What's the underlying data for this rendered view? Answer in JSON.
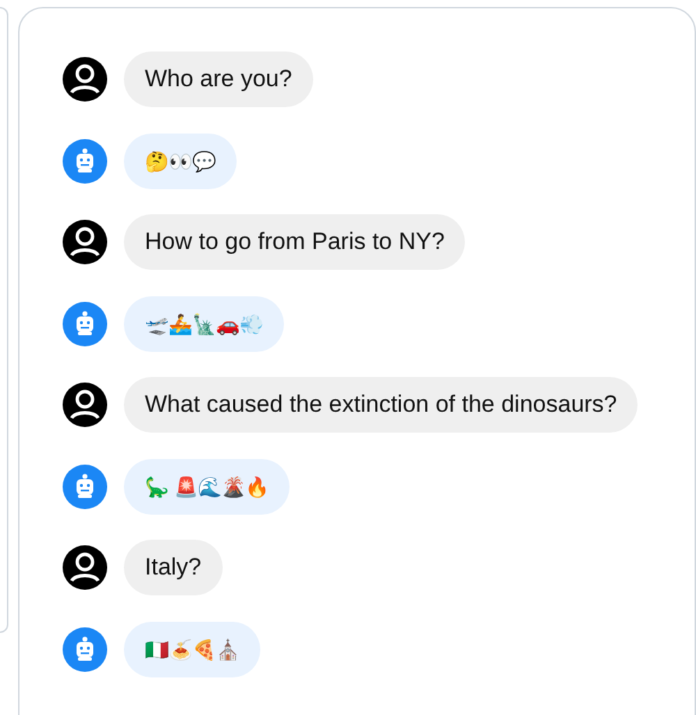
{
  "messages": [
    {
      "kind": "user",
      "text": "Who are you?"
    },
    {
      "kind": "bot",
      "text": "🤔👀💬"
    },
    {
      "kind": "user",
      "text": "How to go from Paris to NY?"
    },
    {
      "kind": "bot",
      "text": "🛫🚣🗽🚗💨"
    },
    {
      "kind": "user",
      "text": "What caused the extinction of the dinosaurs?"
    },
    {
      "kind": "bot",
      "text": "🦕 🚨🌊🌋🔥"
    },
    {
      "kind": "user",
      "text": "Italy?"
    },
    {
      "kind": "bot",
      "text": "🇮🇹🍝🍕⛪"
    }
  ]
}
